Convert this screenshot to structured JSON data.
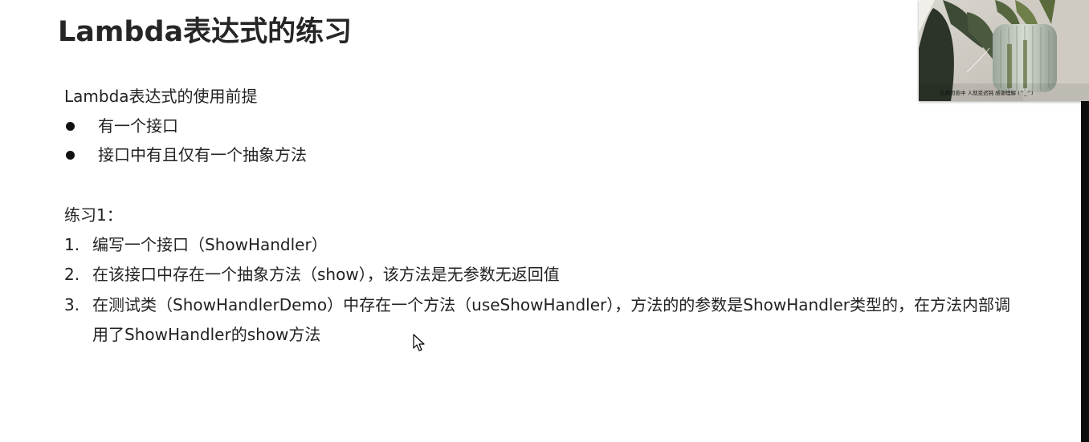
{
  "slide": {
    "title": "Lambda表达式的练习",
    "premise_heading": "Lambda表达式的使用前提",
    "premise_items": [
      "有一个接口",
      "接口中有且仅有一个抽象方法"
    ],
    "exercise_heading": "练习1：",
    "exercise_items": [
      {
        "num": "1.",
        "text": "编写一个接口（ShowHandler）"
      },
      {
        "num": "2.",
        "text": "在该接口中存在一个抽象方法（show），该方法是无参数无返回值"
      },
      {
        "num": "3.",
        "text": "在测试类（ShowHandlerDemo）中存在一个方法（useShowHandler），方法的的参数是ShowHandler类型的，在方法内部调",
        "continuation": "用了ShowHandler的show方法"
      }
    ]
  },
  "webcam": {
    "caption": "生病初愈中 人就变迟钝 感谢理解 (^_^)"
  },
  "colors": {
    "background": "#ffffff",
    "title": "#262626",
    "text": "#222222",
    "bullet": "#111111",
    "right_bar": "#0d0d0d"
  }
}
